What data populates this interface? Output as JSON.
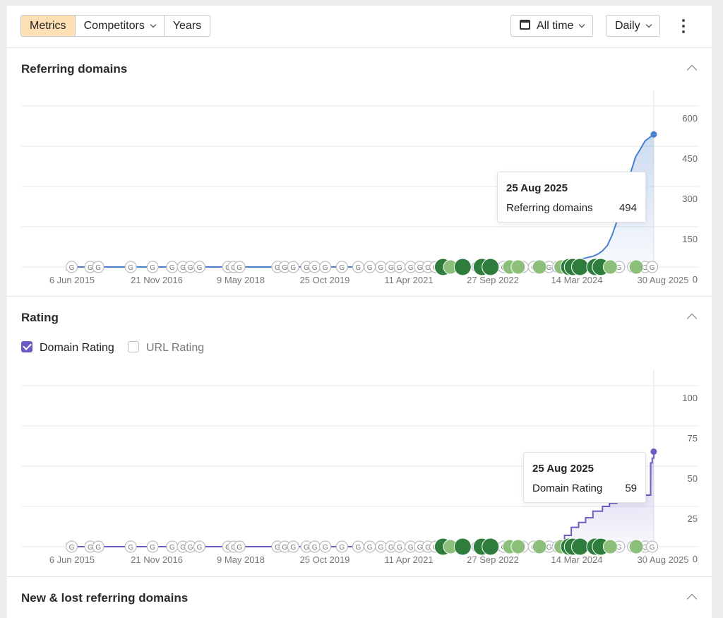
{
  "toolbar": {
    "tabs": [
      {
        "label": "Metrics",
        "active": true
      },
      {
        "label": "Competitors",
        "dropdown": true
      },
      {
        "label": "Years"
      }
    ],
    "range_label": "All time",
    "range_icon": "calendar-icon",
    "interval_label": "Daily",
    "more_icon": "kebab-icon"
  },
  "sections": {
    "referring": {
      "title": "Referring domains"
    },
    "rating": {
      "title": "Rating",
      "legend": [
        {
          "label": "Domain Rating",
          "checked": true
        },
        {
          "label": "URL Rating",
          "checked": false
        }
      ]
    },
    "new_lost": {
      "title": "New & lost referring domains"
    }
  },
  "x_ticks": [
    "6 Jun 2015",
    "21 Nov 2016",
    "9 May 2018",
    "25 Oct 2019",
    "11 Apr 2021",
    "27 Sep 2022",
    "14 Mar 2024",
    "30 Aug 2025"
  ],
  "colors": {
    "rd_line": "#4a80d0",
    "dr_line": "#6b5bc4",
    "marker_dark": "#2e7d3c",
    "marker_light": "#8cc07a",
    "grid": "#e8e8ec"
  },
  "tooltips": {
    "referring": {
      "date": "25 Aug 2025",
      "label": "Referring domains",
      "value": "494"
    },
    "rating": {
      "date": "25 Aug 2025",
      "label": "Domain Rating",
      "value": "59"
    }
  },
  "chart_data": [
    {
      "type": "line",
      "title": "Referring domains",
      "x_range": [
        "2015-06-06",
        "2025-08-30"
      ],
      "y_ticks": [
        "600",
        "450",
        "300",
        "150",
        "0"
      ],
      "ylim": [
        0,
        600
      ],
      "grid": true,
      "series": [
        {
          "name": "Referring domains",
          "points": [
            [
              "2015-06-06",
              0
            ],
            [
              "2023-12-01",
              0
            ],
            [
              "2024-01-15",
              3
            ],
            [
              "2024-02-20",
              8
            ],
            [
              "2024-03-20",
              15
            ],
            [
              "2024-04-20",
              24
            ],
            [
              "2024-05-25",
              30
            ],
            [
              "2024-07-01",
              36
            ],
            [
              "2024-08-01",
              40
            ],
            [
              "2024-09-01",
              48
            ],
            [
              "2024-10-01",
              60
            ],
            [
              "2024-11-01",
              80
            ],
            [
              "2024-12-01",
              118
            ],
            [
              "2025-01-01",
              170
            ],
            [
              "2025-02-01",
              240
            ],
            [
              "2025-03-01",
              300
            ],
            [
              "2025-04-01",
              355
            ],
            [
              "2025-05-01",
              410
            ],
            [
              "2025-06-01",
              440
            ],
            [
              "2025-07-01",
              470
            ],
            [
              "2025-08-25",
              494
            ]
          ]
        }
      ]
    },
    {
      "type": "line",
      "title": "Rating",
      "x_range": [
        "2015-06-06",
        "2025-08-30"
      ],
      "y_ticks": [
        "100",
        "75",
        "50",
        "25",
        "0"
      ],
      "ylim": [
        0,
        100
      ],
      "grid": true,
      "series": [
        {
          "name": "Domain Rating",
          "step": true,
          "points": [
            [
              "2015-06-06",
              0
            ],
            [
              "2023-06-01",
              0
            ],
            [
              "2023-06-15",
              1
            ],
            [
              "2024-01-20",
              1
            ],
            [
              "2024-02-01",
              7
            ],
            [
              "2024-03-15",
              12
            ],
            [
              "2024-05-01",
              15
            ],
            [
              "2024-06-15",
              18
            ],
            [
              "2024-08-01",
              22
            ],
            [
              "2024-10-01",
              25
            ],
            [
              "2024-11-15",
              27
            ],
            [
              "2025-01-01",
              30
            ],
            [
              "2025-03-01",
              32
            ],
            [
              "2025-07-25",
              32
            ],
            [
              "2025-08-05",
              52
            ],
            [
              "2025-08-15",
              55
            ],
            [
              "2025-08-25",
              59
            ]
          ]
        }
      ]
    }
  ],
  "google_markers": [
    "2015-06-13",
    "2015-10-10",
    "2015-11-30",
    "2016-06-25",
    "2016-11-12",
    "2017-03-17",
    "2017-05-25",
    "2017-07-12",
    "2017-09-08",
    "2018-03-10",
    "2018-04-15",
    "2018-05-22",
    "2019-01-20",
    "2019-03-08",
    "2019-05-01",
    "2019-07-25",
    "2019-09-15",
    "2019-11-22",
    "2020-03-08",
    "2020-06-20",
    "2020-09-02",
    "2020-11-12",
    "2021-01-16",
    "2021-03-12",
    "2021-05-22",
    "2021-07-20",
    "2021-09-10",
    "2021-10-28",
    "2022-01-05",
    "2022-03-20",
    "2022-05-10",
    "2022-07-25",
    "2022-09-20",
    "2022-11-10",
    "2023-01-08",
    "2023-03-15",
    "2023-05-10",
    "2023-07-20",
    "2023-09-10",
    "2023-10-25",
    "2023-12-20",
    "2024-02-15",
    "2024-04-30",
    "2024-07-20",
    "2024-10-10",
    "2025-01-15",
    "2025-04-15",
    "2025-07-01",
    "2025-08-15"
  ],
  "update_markers": [
    {
      "date": "2021-12-15",
      "level": "major"
    },
    {
      "date": "2022-02-01",
      "level": "minor"
    },
    {
      "date": "2022-04-20",
      "level": "major"
    },
    {
      "date": "2022-08-20",
      "level": "major"
    },
    {
      "date": "2022-10-15",
      "level": "major"
    },
    {
      "date": "2023-02-15",
      "level": "minor"
    },
    {
      "date": "2023-04-10",
      "level": "minor"
    },
    {
      "date": "2023-08-25",
      "level": "minor"
    },
    {
      "date": "2024-01-10",
      "level": "minor"
    },
    {
      "date": "2024-03-01",
      "level": "major"
    },
    {
      "date": "2024-03-25",
      "level": "major"
    },
    {
      "date": "2024-05-10",
      "level": "major"
    },
    {
      "date": "2024-08-15",
      "level": "major"
    },
    {
      "date": "2024-09-20",
      "level": "major"
    },
    {
      "date": "2024-11-20",
      "level": "minor"
    },
    {
      "date": "2025-05-05",
      "level": "minor"
    }
  ]
}
